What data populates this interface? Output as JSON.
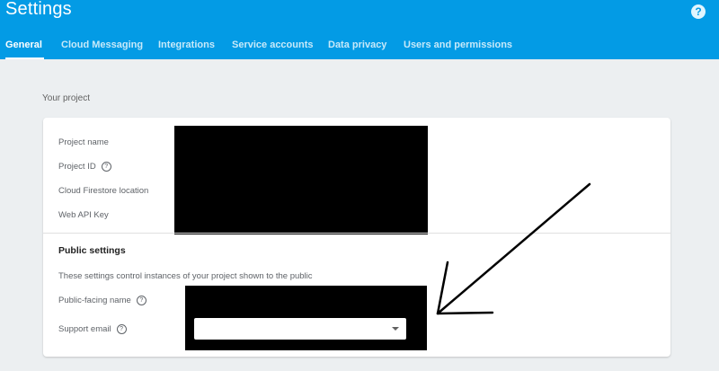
{
  "header": {
    "title": "Settings",
    "help_icon": "help-icon",
    "help_glyph": "?"
  },
  "tabs": [
    {
      "label": "General",
      "active": true
    },
    {
      "label": "Cloud Messaging",
      "active": false
    },
    {
      "label": "Integrations",
      "active": false
    },
    {
      "label": "Service accounts",
      "active": false
    },
    {
      "label": "Data privacy",
      "active": false
    },
    {
      "label": "Users and permissions",
      "active": false
    }
  ],
  "project_section": {
    "title": "Your project",
    "fields": [
      {
        "label": "Project name",
        "help": false
      },
      {
        "label": "Project ID",
        "help": true
      },
      {
        "label": "Cloud Firestore location",
        "help": false
      },
      {
        "label": "Web API Key",
        "help": false
      }
    ]
  },
  "public_settings": {
    "heading": "Public settings",
    "description": "These settings control instances of your project shown to the public",
    "fields": [
      {
        "label": "Public-facing name",
        "help": true
      },
      {
        "label": "Support email",
        "help": true
      }
    ],
    "support_email_value": ""
  },
  "help_glyph_small": "?",
  "colors": {
    "header": "#039be5",
    "page_bg": "#eceff1",
    "card_bg": "#ffffff"
  }
}
